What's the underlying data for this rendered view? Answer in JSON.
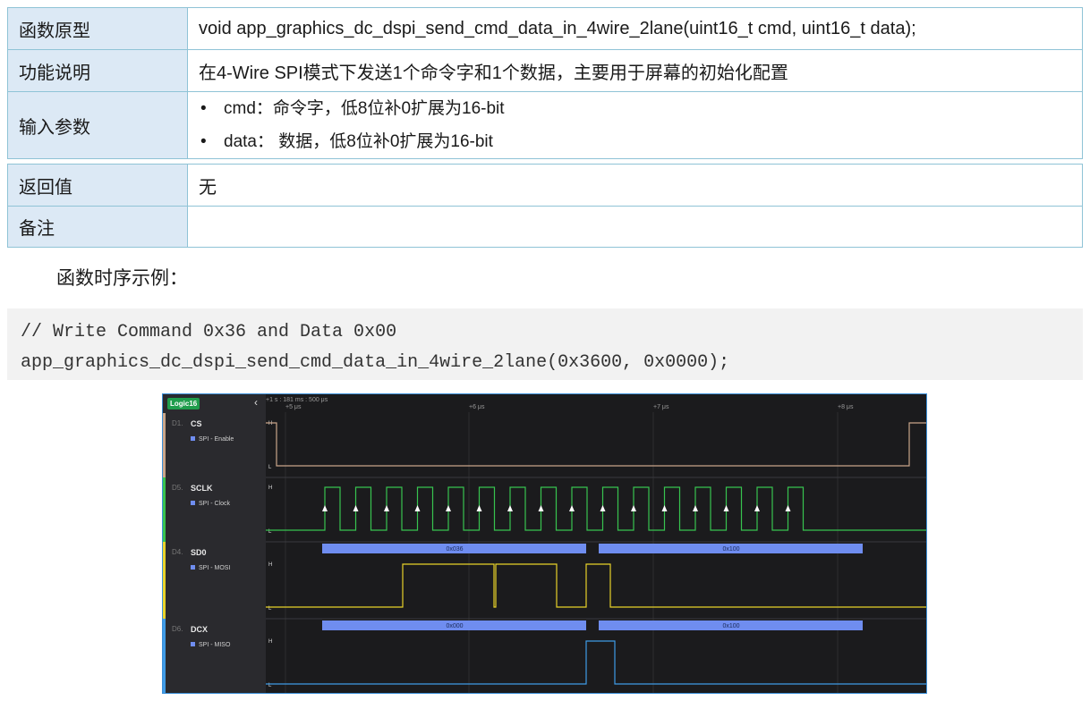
{
  "table": {
    "rows": [
      {
        "key": "函数原型",
        "value": "void app_graphics_dc_dspi_send_cmd_data_in_4wire_2lane(uint16_t cmd, uint16_t data);"
      },
      {
        "key": "功能说明",
        "value": "在4-Wire SPI模式下发送1个命令字和1个数据，主要用于屏幕的初始化配置"
      },
      {
        "key": "输入参数",
        "bullets": [
          "cmd：命令字，低8位补0扩展为16-bit",
          "data： 数据，低8位补0扩展为16-bit"
        ]
      }
    ],
    "rows2": [
      {
        "key": "返回值",
        "value": "无"
      },
      {
        "key": "备注",
        "value": ""
      }
    ]
  },
  "caption": "函数时序示例：",
  "code": {
    "line1": "// Write Command 0x36 and Data 0x00",
    "line2": "app_graphics_dc_dspi_send_cmd_data_in_4wire_2lane(0x3600, 0x0000);"
  },
  "analyzer": {
    "device": "Logic16",
    "collapse_icon": "chevron-left-icon",
    "time_header": "+1 s : 181 ms : 500 μs",
    "time_ticks": [
      "+5 μs",
      "+6 μs",
      "+7 μs",
      "+8 μs"
    ],
    "level_high": "H",
    "level_low": "L",
    "channels": [
      {
        "id": "D1.",
        "name": "CS",
        "protocol": "SPI - Enable",
        "color": "#c9a58a"
      },
      {
        "id": "D5.",
        "name": "SCLK",
        "protocol": "SPI - Clock",
        "color": "#37c44f"
      },
      {
        "id": "D4.",
        "name": "SD0",
        "protocol": "SPI - MOSI",
        "color": "#e8d22a"
      },
      {
        "id": "D6.",
        "name": "DCX",
        "protocol": "SPI - MISO",
        "color": "#3f9be6"
      }
    ],
    "decodes": {
      "mosi": [
        "0x036",
        "0x100"
      ],
      "miso": [
        "0x000",
        "0x100"
      ]
    },
    "decode_color": "#6f8df0"
  }
}
